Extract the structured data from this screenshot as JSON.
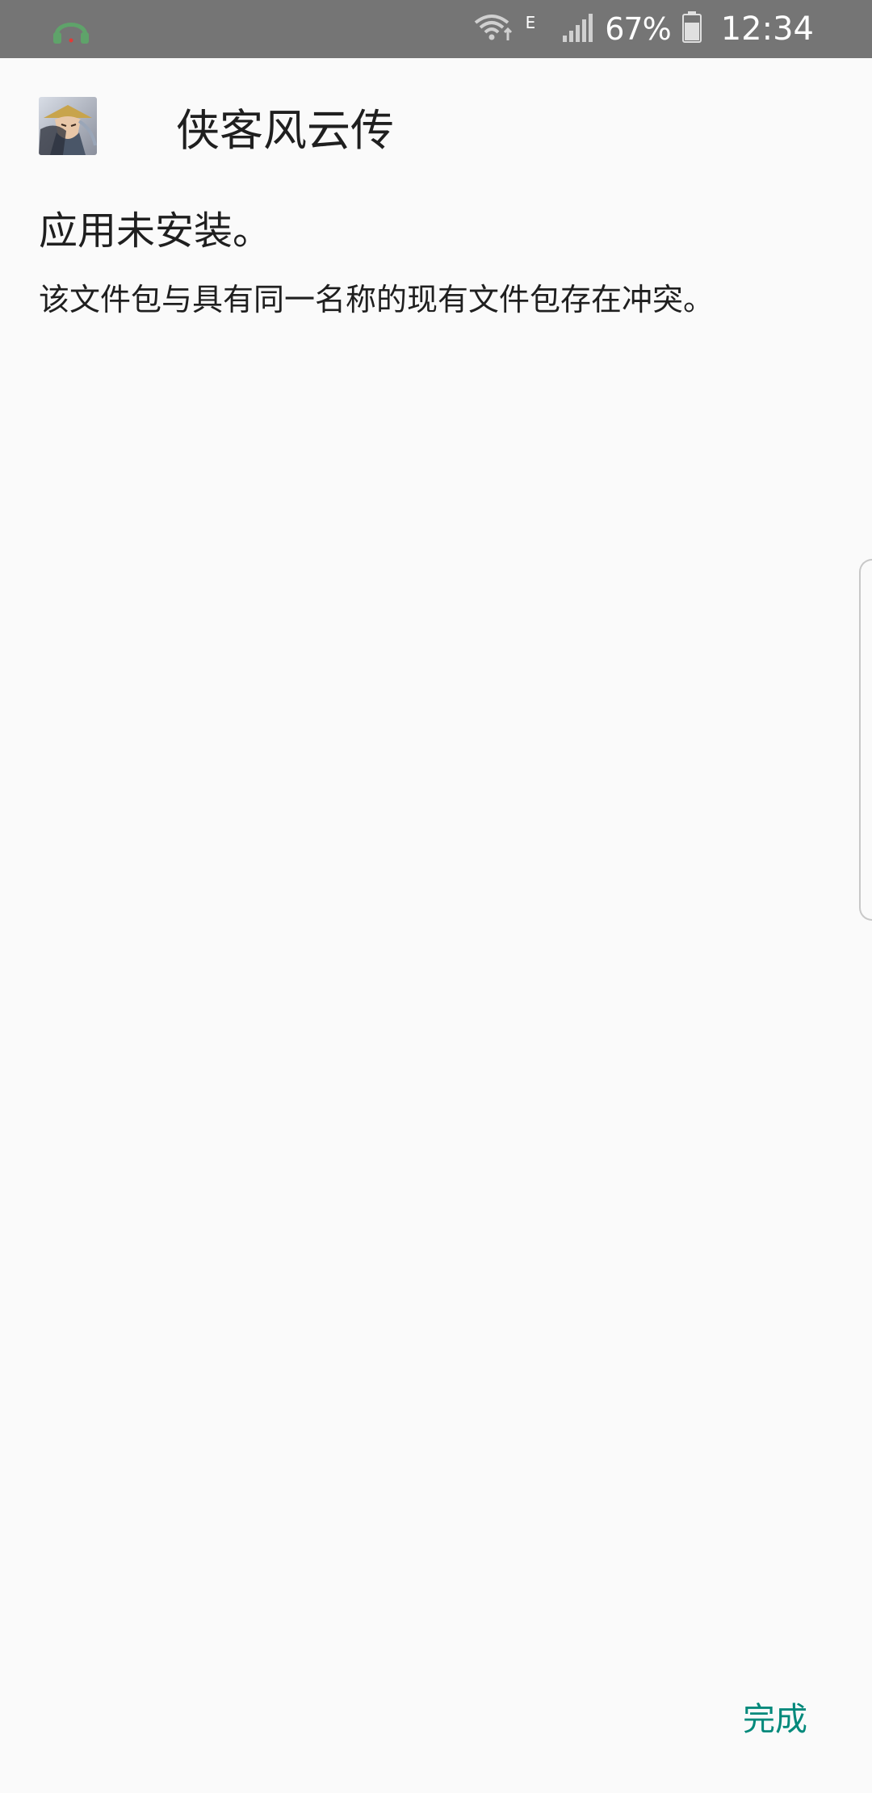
{
  "status_bar": {
    "battery": "67%",
    "time": "12:34",
    "network_type": "E",
    "icons": [
      "headset-icon",
      "wifi-icon",
      "signal-icon",
      "battery-icon"
    ],
    "accent": "#4caf50"
  },
  "app": {
    "name": "侠客风云传",
    "icon": "app-icon"
  },
  "install": {
    "status": "应用未安装。",
    "detail": "该文件包与具有同一名称的现有文件包存在冲突。"
  },
  "actions": {
    "done_label": "完成",
    "done_color": "#00897b"
  }
}
